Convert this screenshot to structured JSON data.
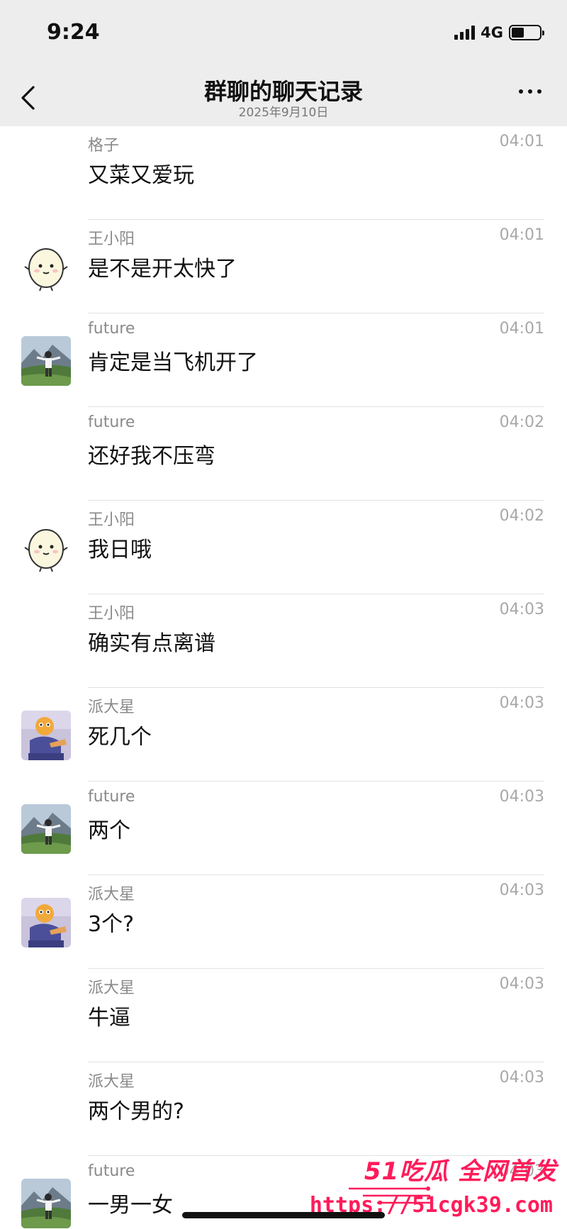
{
  "status": {
    "time": "9:24",
    "network": "4G"
  },
  "nav": {
    "title": "群聊的聊天记录",
    "subtitle": "2025年9月10日"
  },
  "messages": [
    {
      "sender": "格子",
      "time": "04:01",
      "text": "又菜又爱玩",
      "avatar": "none"
    },
    {
      "sender": "王小阳",
      "time": "04:01",
      "text": "是不是开太快了",
      "avatar": "egg"
    },
    {
      "sender": "future",
      "time": "04:01",
      "text": "肯定是当飞机开了",
      "avatar": "landscape"
    },
    {
      "sender": "future",
      "time": "04:02",
      "text": "还好我不压弯",
      "avatar": "none"
    },
    {
      "sender": "王小阳",
      "time": "04:02",
      "text": "我日哦",
      "avatar": "egg"
    },
    {
      "sender": "王小阳",
      "time": "04:03",
      "text": "确实有点离谱",
      "avatar": "none"
    },
    {
      "sender": "派大星",
      "time": "04:03",
      "text": "死几个",
      "avatar": "cartoon"
    },
    {
      "sender": "future",
      "time": "04:03",
      "text": "两个",
      "avatar": "landscape"
    },
    {
      "sender": "派大星",
      "time": "04:03",
      "text": "3个?",
      "avatar": "cartoon"
    },
    {
      "sender": "派大星",
      "time": "04:03",
      "text": "牛逼",
      "avatar": "none"
    },
    {
      "sender": "派大星",
      "time": "04:03",
      "text": "两个男的?",
      "avatar": "none"
    },
    {
      "sender": "future",
      "time": "04:03",
      "text": "一男一女",
      "avatar": "landscape"
    }
  ],
  "watermark": {
    "brand": "51吃瓜 全网首发",
    "url": "https://51cgk39.com"
  },
  "colors": {
    "topbar": "#ededed",
    "divider": "#e2e2e2",
    "watermark": "#ff1b5a"
  }
}
